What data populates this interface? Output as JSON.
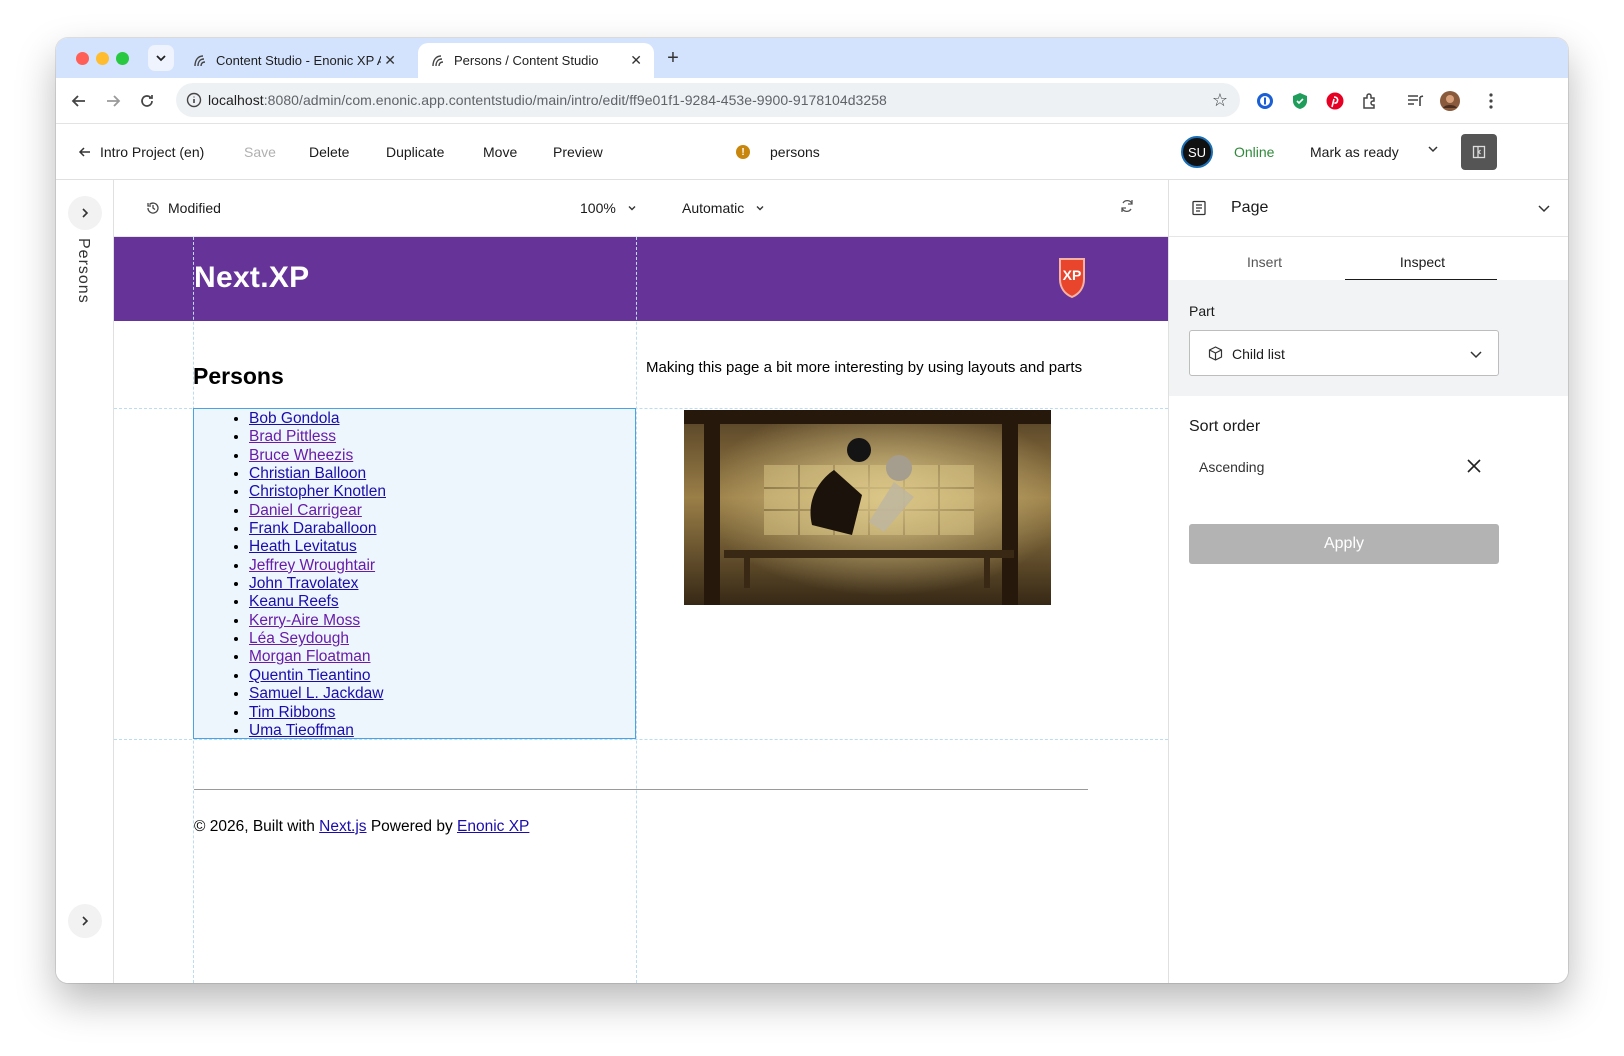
{
  "browser": {
    "tabs": [
      {
        "title": "Content Studio - Enonic XP Admin",
        "active": false
      },
      {
        "title": "Persons / Content Studio",
        "active": true
      }
    ],
    "url_host": "localhost",
    "url_rest": ":8080/admin/com.enonic.app.contentstudio/main/intro/edit/ff9e01f1-9284-453e-9900-9178104d3258"
  },
  "app_header": {
    "back_label": "Intro Project (en)",
    "save_label": "Save",
    "delete_label": "Delete",
    "duplicate_label": "Duplicate",
    "move_label": "Move",
    "preview_label": "Preview",
    "content_name": "persons",
    "avatar_initials": "SU",
    "status": "Online",
    "mark_label": "Mark as ready"
  },
  "left_rail": {
    "label": "Persons"
  },
  "preview_controls": {
    "state": "Modified",
    "zoom": "100%",
    "device": "Automatic"
  },
  "page": {
    "brand": "Next.XP",
    "badge": "XP",
    "heading": "Persons",
    "blurb": "Making this page a bit more interesting by using layouts and parts",
    "persons": [
      "Bob Gondola",
      "Brad Pittless",
      "Bruce Wheezis",
      "Christian Balloon",
      "Christopher Knotlen",
      "Daniel Carrigear",
      "Frank Daraballoon",
      "Heath Levitatus",
      "Jeffrey Wroughtair",
      "John Travolatex",
      "Keanu Reefs",
      "Kerry-Aire Moss",
      "Léa Seydough",
      "Morgan Floatman",
      "Quentin Tieantino",
      "Samuel L. Jackdaw",
      "Tim Ribbons",
      "Uma Tieoffman"
    ],
    "footer": {
      "prefix": "© 2026, Built with ",
      "link1": "Next.js",
      "middle": " Powered by ",
      "link2": "Enonic XP"
    }
  },
  "right_panel": {
    "title": "Page",
    "tabs": [
      "Insert",
      "Inspect"
    ],
    "active_tab": "Inspect",
    "part_label": "Part",
    "part_value": "Child list",
    "sort_label": "Sort order",
    "sort_value": "Ascending",
    "apply_label": "Apply"
  },
  "colors": {
    "banner": "#663399",
    "accent_link": "#1a0dab",
    "online": "#2f8a3a",
    "selection_border": "#4aa3e2"
  }
}
